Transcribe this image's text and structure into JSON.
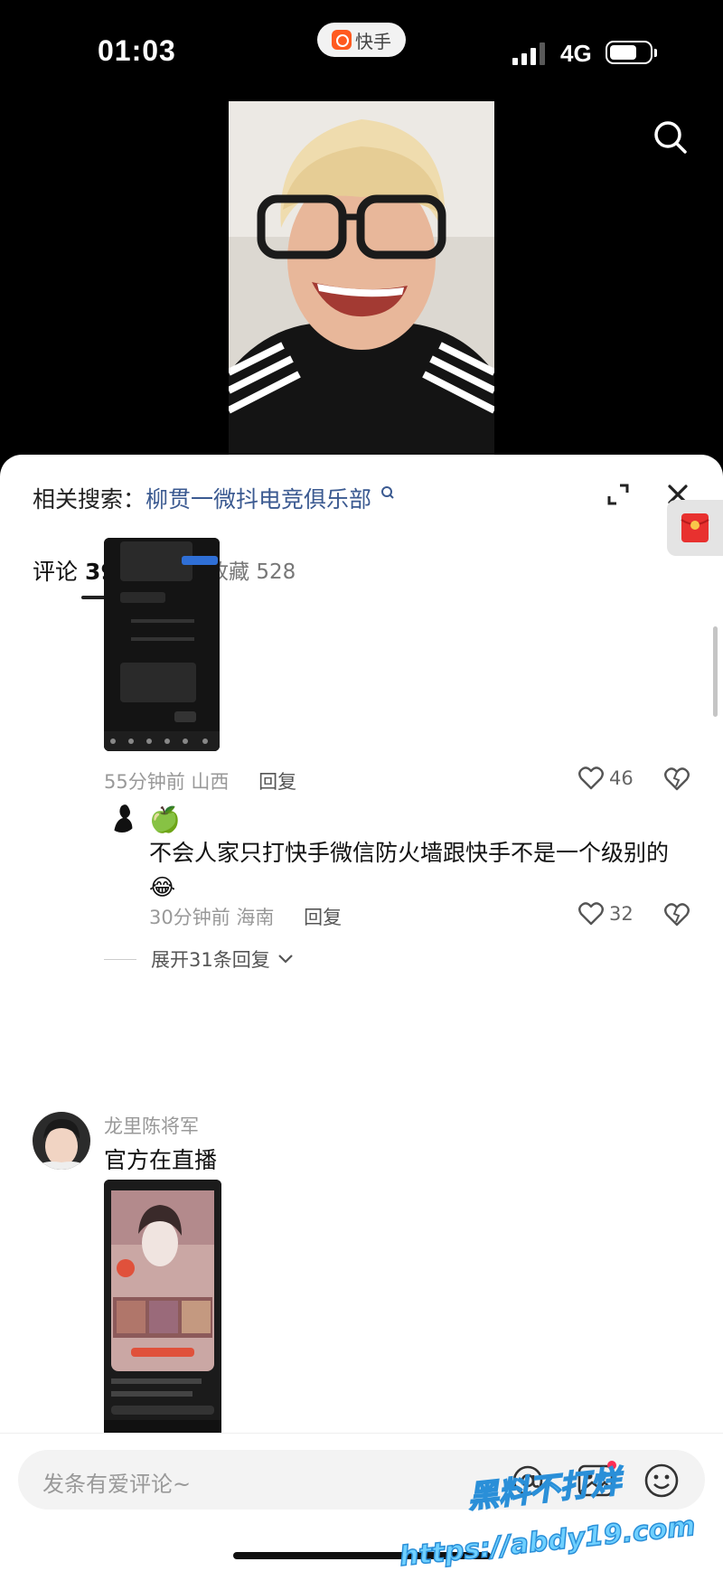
{
  "status_bar": {
    "time": "01:03",
    "app_pill": "快手",
    "network": "4G",
    "signal_level": 3,
    "battery_level": 0.7
  },
  "sheet": {
    "related_search": {
      "label": "相关搜索：",
      "query": "柳贯一微抖电竞俱乐部"
    },
    "tabs": [
      {
        "label": "评论",
        "count": "3965"
      },
      {
        "label": "收藏",
        "count": "528"
      }
    ],
    "comments": [
      {
        "time": "55分钟前",
        "location": "山西",
        "reply_label": "回复",
        "likes": "46",
        "replies": [
          {
            "emoji_name": "🍏",
            "text": "不会人家只打快手微信防火墙跟快手不是一个级别的😂",
            "time": "30分钟前",
            "location": "海南",
            "reply_label": "回复",
            "likes": "32"
          }
        ],
        "expand_label": "展开31条回复"
      },
      {
        "username": "龙里陈将军",
        "text": "官方在直播"
      }
    ]
  },
  "bottom": {
    "input_placeholder": "发条有爱评论~"
  },
  "watermark": {
    "line1": "黑料不打烊",
    "line2": "https://abdy19.com"
  },
  "colors": {
    "accent_blue": "#3b5a91",
    "kuaishou_orange": "#ff5a1f",
    "red": "#ff2d55"
  }
}
